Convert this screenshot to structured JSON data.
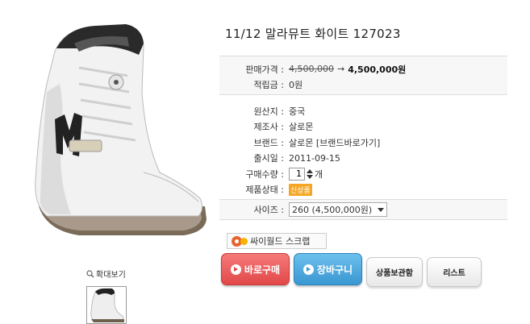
{
  "product": {
    "title": "11/12 말라뮤트 화이트 127023",
    "image_icon": "snowboard-boot-image",
    "zoom_label": "확대보기"
  },
  "price": {
    "label": "판매가격 :",
    "original": "4,500,000",
    "arrow": "→",
    "sale": "4,500,000원"
  },
  "points": {
    "label": "적립금 :",
    "value": "0원"
  },
  "origin": {
    "label": "원산지 :",
    "value": "중국"
  },
  "maker": {
    "label": "제조사 :",
    "value": "살로몬"
  },
  "brand": {
    "label": "브랜드 :",
    "value": "살로몬 [브랜드바로가기]"
  },
  "release": {
    "label": "출시일 :",
    "value": "2011-09-15"
  },
  "quantity": {
    "label": "구매수량 :",
    "value": "1",
    "unit": "개"
  },
  "condition": {
    "label": "제품상태 :",
    "badge": "신상품"
  },
  "size": {
    "label": "사이즈 :",
    "selected": "260 (4,500,000원)"
  },
  "actions": {
    "cyworld": "싸이월드 스크랩",
    "buy": "바로구매",
    "cart": "장바구니",
    "keep": "상품보관함",
    "list": "리스트"
  },
  "colors": {
    "buy": "#e24848",
    "cart": "#3a97d2",
    "badge": "#f5a623"
  }
}
